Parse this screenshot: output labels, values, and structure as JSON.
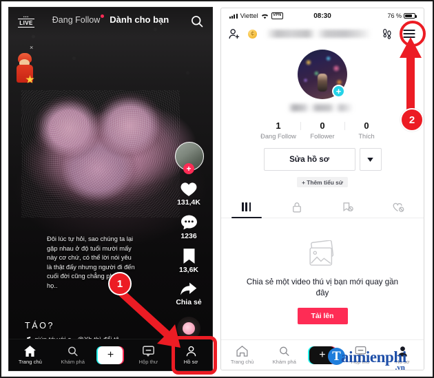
{
  "left_phone": {
    "live_badge": "LIVE",
    "tabs": [
      {
        "label": "Đang Follow",
        "active": false,
        "dot": true
      },
      {
        "label": "Dành cho bạn",
        "active": true,
        "dot": false
      }
    ],
    "search_icon": "search-icon",
    "gift_sticker": {
      "close": "×"
    },
    "rail": {
      "avatar_plus": "+",
      "likes": "131,4K",
      "comments": "1236",
      "bookmarks": "13,6K",
      "share_label": "Chia sẻ"
    },
    "caption": "Đôi lúc tự hỏi, sao chúng ta lại gặp nhau ở độ tuổi mười mấy này cơ chứ, có thể lời nói yêu là thật đấy nhưng người đi đến cuối đời cũng chẳng phải là họ..",
    "title": "TÁO?",
    "music": "giúp tớ với ạ - @Xh thì đổi tê",
    "bottom_nav": [
      {
        "label": "Trang chủ",
        "icon": "home-icon"
      },
      {
        "label": "Khám phá",
        "icon": "search-icon"
      },
      {
        "label": "",
        "icon": "plus-icon"
      },
      {
        "label": "Hộp thư",
        "icon": "inbox-icon"
      },
      {
        "label": "Hồ sơ",
        "icon": "profile-icon"
      }
    ]
  },
  "right_phone": {
    "status_bar": {
      "carrier": "Viettel",
      "wifi_icon": "wifi-icon",
      "vpn": "VPN",
      "time": "08:30",
      "battery_percent": "76 %"
    },
    "header": {
      "add_friend_icon": "add-person-icon",
      "coin_icon": "coin-icon",
      "username": "",
      "footprint_icon": "footprints-icon",
      "menu_icon": "hamburger-menu-icon"
    },
    "profile": {
      "avatar_plus": "+",
      "display_name": "",
      "stats": [
        {
          "num": "1",
          "label": "Đang Follow"
        },
        {
          "num": "0",
          "label": "Follower"
        },
        {
          "num": "0",
          "label": "Thích"
        }
      ],
      "edit_button": "Sửa hồ sơ",
      "caret": "▾",
      "add_bio_button": "+ Thêm tiểu sử"
    },
    "tabs": [
      {
        "icon": "grid-icon",
        "active": true
      },
      {
        "icon": "lock-icon",
        "active": false
      },
      {
        "icon": "bookmark-off-icon",
        "active": false
      },
      {
        "icon": "heart-off-icon",
        "active": false
      }
    ],
    "empty_state": {
      "icon": "photo-stack-icon",
      "text": "Chia sẻ một video thú vị bạn mới quay gần đây",
      "button": "Tải lên"
    },
    "bottom_nav": [
      {
        "label": "Trang chủ",
        "icon": "home-icon"
      },
      {
        "label": "Khám phá",
        "icon": "search-icon"
      },
      {
        "label": "",
        "icon": "plus-icon"
      },
      {
        "label": "Hộp thư",
        "icon": "inbox-icon"
      },
      {
        "label": "Hồ sơ",
        "icon": "profile-icon"
      }
    ]
  },
  "annotations": [
    {
      "badge": "1",
      "target": "profile-tab-left"
    },
    {
      "badge": "2",
      "target": "hamburger-menu-right"
    }
  ],
  "watermark": {
    "logo_letter": "T",
    "name": "aimienphi",
    "tld": ".vn"
  },
  "colors": {
    "accent_red": "#fe2c55",
    "annotation_red": "#ec1c24",
    "cyan": "#25f4ee",
    "watermark_blue": "#1f4fa8"
  }
}
